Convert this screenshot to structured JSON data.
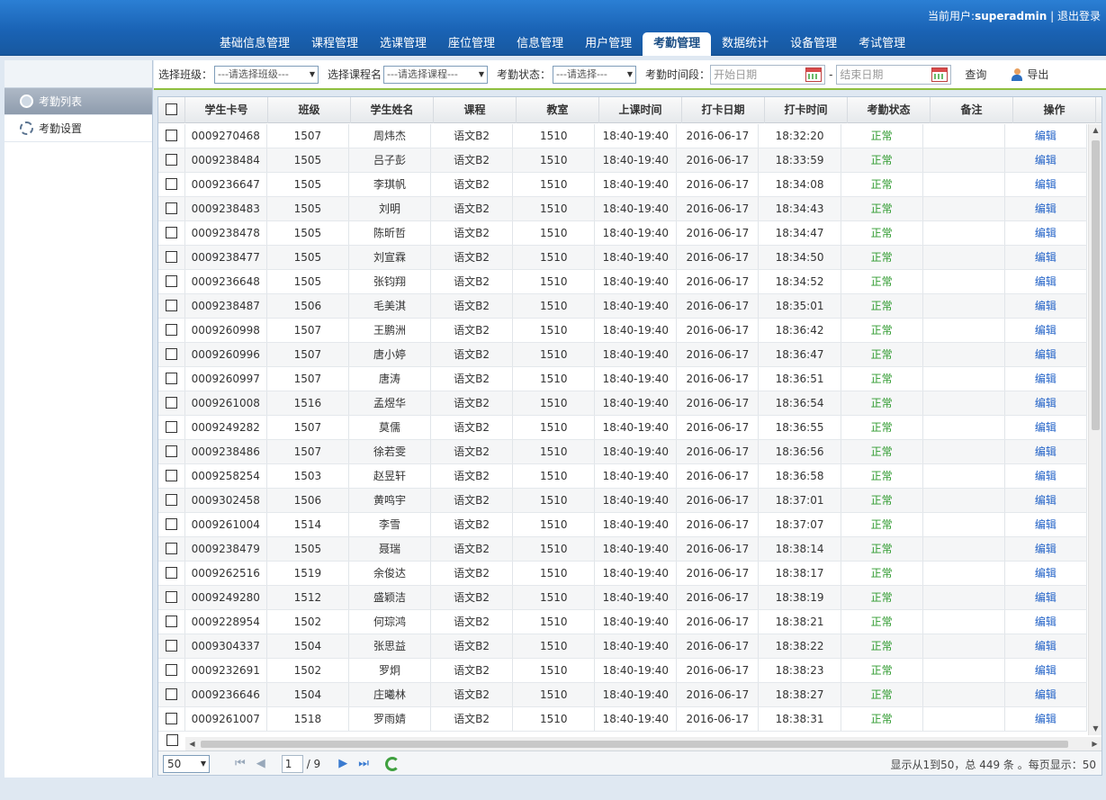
{
  "header": {
    "user_label": "当前用户:",
    "username": "superadmin",
    "separator": "|",
    "logout": "退出登录"
  },
  "nav": {
    "tabs": [
      "基础信息管理",
      "课程管理",
      "选课管理",
      "座位管理",
      "信息管理",
      "用户管理",
      "考勤管理",
      "数据统计",
      "设备管理",
      "考试管理"
    ],
    "active": "考勤管理"
  },
  "sidebar": {
    "items": [
      {
        "label": "考勤列表",
        "icon": "clock-icon",
        "active": true
      },
      {
        "label": "考勤设置",
        "icon": "gear-icon",
        "active": false
      }
    ]
  },
  "toolbar": {
    "class_label": "选择班级：",
    "class_select": "---请选择班级---",
    "course_label": "选择课程名",
    "course_select": "---请选择课程---",
    "status_label": "考勤状态：",
    "status_select": "---请选择---",
    "period_label": "考勤时间段：",
    "start_placeholder": "开始日期",
    "dash": "-",
    "end_placeholder": "结束日期",
    "query": "查询",
    "export": "导出"
  },
  "table": {
    "columns": [
      "学生卡号",
      "班级",
      "学生姓名",
      "课程",
      "教室",
      "上课时间",
      "打卡日期",
      "打卡时间",
      "考勤状态",
      "备注",
      "操作"
    ],
    "rows": [
      [
        "0009270468",
        "1507",
        "周炜杰",
        "语文B2",
        "1510",
        "18:40-19:40",
        "2016-06-17",
        "18:32:20",
        "正常",
        "",
        "编辑"
      ],
      [
        "0009238484",
        "1505",
        "吕子彭",
        "语文B2",
        "1510",
        "18:40-19:40",
        "2016-06-17",
        "18:33:59",
        "正常",
        "",
        "编辑"
      ],
      [
        "0009236647",
        "1505",
        "李琪帆",
        "语文B2",
        "1510",
        "18:40-19:40",
        "2016-06-17",
        "18:34:08",
        "正常",
        "",
        "编辑"
      ],
      [
        "0009238483",
        "1505",
        "刘明",
        "语文B2",
        "1510",
        "18:40-19:40",
        "2016-06-17",
        "18:34:43",
        "正常",
        "",
        "编辑"
      ],
      [
        "0009238478",
        "1505",
        "陈昕哲",
        "语文B2",
        "1510",
        "18:40-19:40",
        "2016-06-17",
        "18:34:47",
        "正常",
        "",
        "编辑"
      ],
      [
        "0009238477",
        "1505",
        "刘宣霖",
        "语文B2",
        "1510",
        "18:40-19:40",
        "2016-06-17",
        "18:34:50",
        "正常",
        "",
        "编辑"
      ],
      [
        "0009236648",
        "1505",
        "张钧翔",
        "语文B2",
        "1510",
        "18:40-19:40",
        "2016-06-17",
        "18:34:52",
        "正常",
        "",
        "编辑"
      ],
      [
        "0009238487",
        "1506",
        "毛美淇",
        "语文B2",
        "1510",
        "18:40-19:40",
        "2016-06-17",
        "18:35:01",
        "正常",
        "",
        "编辑"
      ],
      [
        "0009260998",
        "1507",
        "王鹏洲",
        "语文B2",
        "1510",
        "18:40-19:40",
        "2016-06-17",
        "18:36:42",
        "正常",
        "",
        "编辑"
      ],
      [
        "0009260996",
        "1507",
        "唐小婷",
        "语文B2",
        "1510",
        "18:40-19:40",
        "2016-06-17",
        "18:36:47",
        "正常",
        "",
        "编辑"
      ],
      [
        "0009260997",
        "1507",
        "唐涛",
        "语文B2",
        "1510",
        "18:40-19:40",
        "2016-06-17",
        "18:36:51",
        "正常",
        "",
        "编辑"
      ],
      [
        "0009261008",
        "1516",
        "孟煜华",
        "语文B2",
        "1510",
        "18:40-19:40",
        "2016-06-17",
        "18:36:54",
        "正常",
        "",
        "编辑"
      ],
      [
        "0009249282",
        "1507",
        "莫儒",
        "语文B2",
        "1510",
        "18:40-19:40",
        "2016-06-17",
        "18:36:55",
        "正常",
        "",
        "编辑"
      ],
      [
        "0009238486",
        "1507",
        "徐若雯",
        "语文B2",
        "1510",
        "18:40-19:40",
        "2016-06-17",
        "18:36:56",
        "正常",
        "",
        "编辑"
      ],
      [
        "0009258254",
        "1503",
        "赵昱轩",
        "语文B2",
        "1510",
        "18:40-19:40",
        "2016-06-17",
        "18:36:58",
        "正常",
        "",
        "编辑"
      ],
      [
        "0009302458",
        "1506",
        "黄鸣宇",
        "语文B2",
        "1510",
        "18:40-19:40",
        "2016-06-17",
        "18:37:01",
        "正常",
        "",
        "编辑"
      ],
      [
        "0009261004",
        "1514",
        "李雪",
        "语文B2",
        "1510",
        "18:40-19:40",
        "2016-06-17",
        "18:37:07",
        "正常",
        "",
        "编辑"
      ],
      [
        "0009238479",
        "1505",
        "聂瑞",
        "语文B2",
        "1510",
        "18:40-19:40",
        "2016-06-17",
        "18:38:14",
        "正常",
        "",
        "编辑"
      ],
      [
        "0009262516",
        "1519",
        "余俊达",
        "语文B2",
        "1510",
        "18:40-19:40",
        "2016-06-17",
        "18:38:17",
        "正常",
        "",
        "编辑"
      ],
      [
        "0009249280",
        "1512",
        "盛颖洁",
        "语文B2",
        "1510",
        "18:40-19:40",
        "2016-06-17",
        "18:38:19",
        "正常",
        "",
        "编辑"
      ],
      [
        "0009228954",
        "1502",
        "何琮鸿",
        "语文B2",
        "1510",
        "18:40-19:40",
        "2016-06-17",
        "18:38:21",
        "正常",
        "",
        "编辑"
      ],
      [
        "0009304337",
        "1504",
        "张思益",
        "语文B2",
        "1510",
        "18:40-19:40",
        "2016-06-17",
        "18:38:22",
        "正常",
        "",
        "编辑"
      ],
      [
        "0009232691",
        "1502",
        "罗炯",
        "语文B2",
        "1510",
        "18:40-19:40",
        "2016-06-17",
        "18:38:23",
        "正常",
        "",
        "编辑"
      ],
      [
        "0009236646",
        "1504",
        "庄曦林",
        "语文B2",
        "1510",
        "18:40-19:40",
        "2016-06-17",
        "18:38:27",
        "正常",
        "",
        "编辑"
      ],
      [
        "0009261007",
        "1518",
        "罗雨婧",
        "语文B2",
        "1510",
        "18:40-19:40",
        "2016-06-17",
        "18:38:31",
        "正常",
        "",
        "编辑"
      ]
    ]
  },
  "pager": {
    "page_size": "50",
    "current_page": "1",
    "total_pages": "/ 9",
    "info": "显示从1到50，总 449 条 。每页显示：50"
  },
  "colors": {
    "header_blue": "#1a63b5",
    "status_ok": "#2e9a2e",
    "link": "#2262c7",
    "toolbar_accent": "#8fbf3f"
  }
}
